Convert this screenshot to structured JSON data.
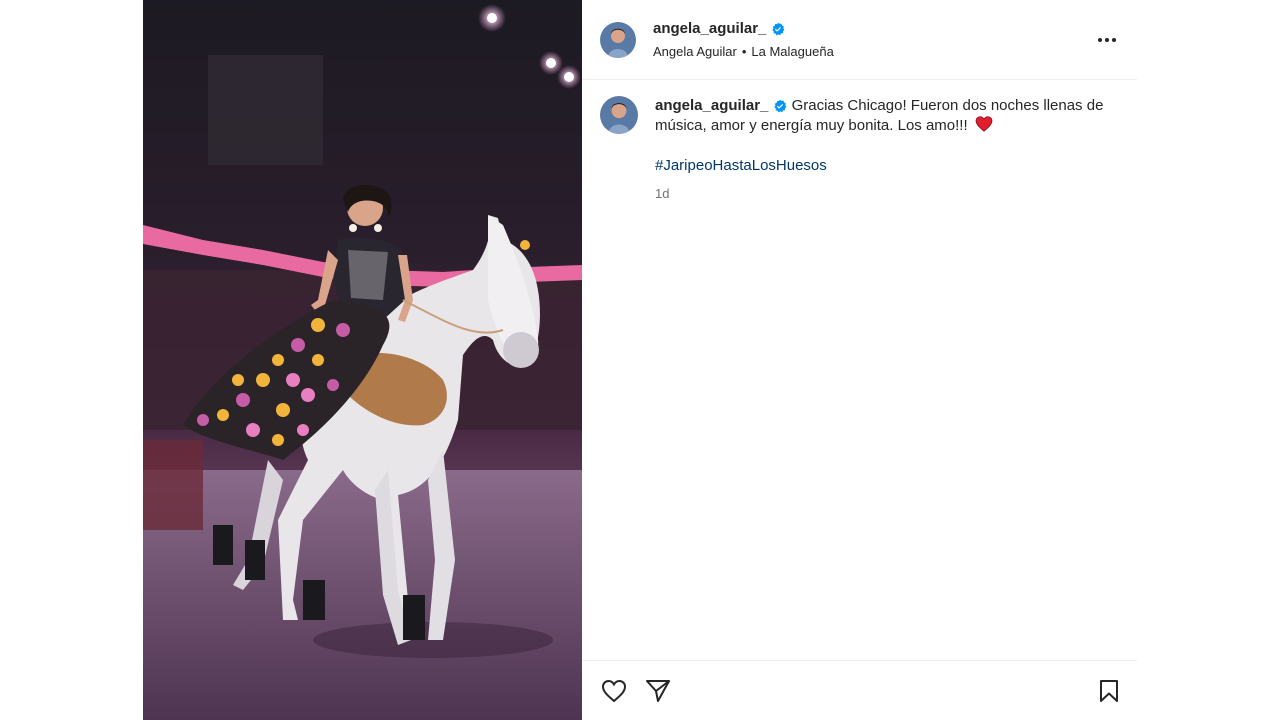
{
  "post": {
    "author": {
      "username": "angela_aguilar_",
      "display_name": "Angela Aguilar",
      "verified": true
    },
    "header_separator": "•",
    "audio": "La Malagueña",
    "caption": "Gracias Chicago! Fueron dos noches llenas de música, amor y energía muy bonita. Los amo!!!",
    "caption_emoji": "red-heart",
    "hashtag": "#JaripeoHastaLosHuesos",
    "time_ago": "1d"
  },
  "icons": {
    "more": "more-options-icon",
    "like": "heart-icon",
    "share": "send-icon",
    "save": "bookmark-icon",
    "verified": "verified-badge-icon"
  },
  "colors": {
    "verified": "#0095f6",
    "hashtag": "#00376b",
    "muted": "#737373",
    "heart": "#ed4956"
  }
}
